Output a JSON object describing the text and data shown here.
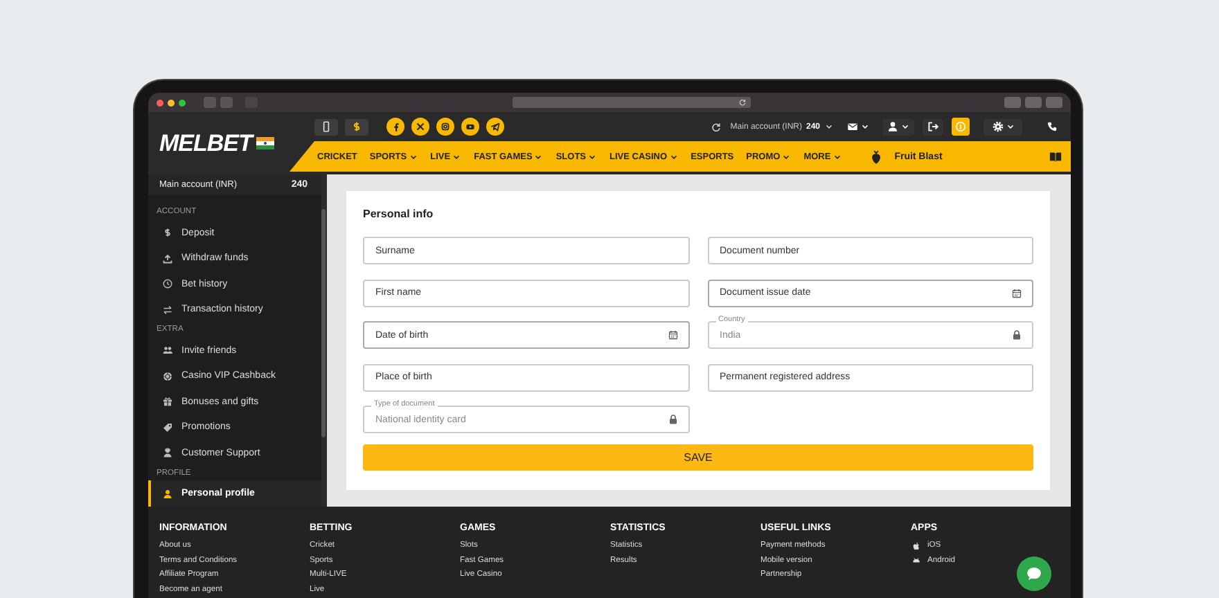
{
  "header": {
    "logo": "MELBET",
    "account": {
      "label": "Main account (INR)",
      "balance": "240"
    },
    "nav": [
      {
        "label": "CRICKET",
        "has_menu": false
      },
      {
        "label": "SPORTS",
        "has_menu": true
      },
      {
        "label": "LIVE",
        "has_menu": true
      },
      {
        "label": "FAST GAMES",
        "has_menu": true
      },
      {
        "label": "SLOTS",
        "has_menu": true
      },
      {
        "label": "LIVE CASINO",
        "has_menu": true
      },
      {
        "label": "ESPORTS",
        "has_menu": false
      },
      {
        "label": "PROMO",
        "has_menu": true
      },
      {
        "label": "MORE",
        "has_menu": true
      }
    ],
    "featured": "Fruit Blast"
  },
  "sidebar": {
    "account": {
      "label": "Main account (INR)",
      "balance": "240"
    },
    "sections": [
      {
        "title": "ACCOUNT",
        "items": [
          {
            "label": "Deposit",
            "selected": false
          },
          {
            "label": "Withdraw funds",
            "selected": false
          },
          {
            "label": "Bet history",
            "selected": false
          },
          {
            "label": "Transaction history",
            "selected": false
          }
        ]
      },
      {
        "title": "EXTRA",
        "items": [
          {
            "label": "Invite friends",
            "selected": false
          },
          {
            "label": "Casino VIP Cashback",
            "selected": false
          },
          {
            "label": "Bonuses and gifts",
            "selected": false
          },
          {
            "label": "Promotions",
            "selected": false
          },
          {
            "label": "Customer Support",
            "selected": false
          }
        ]
      },
      {
        "title": "PROFILE",
        "items": [
          {
            "label": "Personal profile",
            "selected": true
          }
        ]
      }
    ]
  },
  "form": {
    "title": "Personal info",
    "fields": [
      {
        "kind": "text",
        "placeholder": "Surname"
      },
      {
        "kind": "text",
        "placeholder": "First name"
      },
      {
        "kind": "date",
        "placeholder": "Date of birth"
      },
      {
        "kind": "text",
        "placeholder": "Place of birth"
      },
      {
        "kind": "locked",
        "label": "Type of document",
        "value": "National identity card"
      },
      {
        "kind": "text",
        "placeholder": "Document number"
      },
      {
        "kind": "date",
        "placeholder": "Document issue date"
      },
      {
        "kind": "locked",
        "label": "Country",
        "value": "India"
      },
      {
        "kind": "text",
        "placeholder": "Permanent registered address"
      }
    ],
    "save": "SAVE"
  },
  "footer": {
    "columns": [
      {
        "title": "INFORMATION",
        "links": [
          "About us",
          "Terms and Conditions",
          "Affiliate Program",
          "Become an agent"
        ]
      },
      {
        "title": "BETTING",
        "links": [
          "Cricket",
          "Sports",
          "Multi-LIVE",
          "Live"
        ]
      },
      {
        "title": "GAMES",
        "links": [
          "Slots",
          "Fast Games",
          "Live Casino"
        ]
      },
      {
        "title": "STATISTICS",
        "links": [
          "Statistics",
          "Results"
        ]
      },
      {
        "title": "USEFUL LINKS",
        "links": [
          "Payment methods",
          "Mobile version",
          "Partnership"
        ]
      },
      {
        "title": "APPS",
        "kind": "apps",
        "links": [
          "iOS",
          "Android"
        ]
      }
    ]
  }
}
